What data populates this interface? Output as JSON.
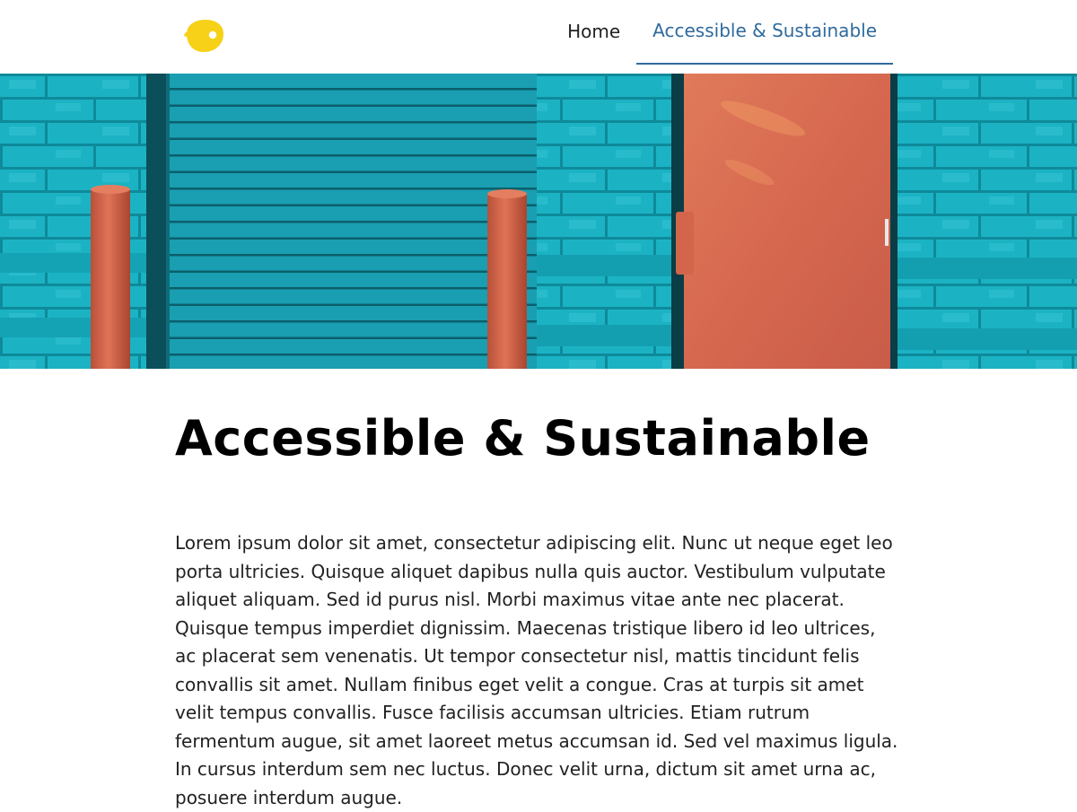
{
  "brand": {
    "logo": "lemon-logo-icon",
    "logo_color": "#f7d117"
  },
  "nav": {
    "items": [
      {
        "label": "Home"
      },
      {
        "label": "Accessible & Sustainable",
        "active": true
      }
    ],
    "active_color": "#2f6a9e"
  },
  "hero": {
    "image": "hero-image",
    "colors": {
      "wall": "#1ab0c2",
      "door": "#d9694f",
      "bollard": "#d4633d"
    }
  },
  "page": {
    "title": "Accessible & Sustainable",
    "body": "Lorem ipsum dolor sit amet, consectetur adipiscing elit. Nunc ut neque eget leo porta ultricies. Quisque aliquet dapibus nulla quis auctor. Vestibulum vulputate aliquet aliquam. Sed id purus nisl. Morbi maximus vitae ante nec placerat. Quisque tempus imperdiet dignissim. Maecenas tristique libero id leo ultrices, ac placerat sem venenatis. Ut tempor consectetur nisl, mattis tincidunt felis convallis sit amet. Nullam finibus eget velit a congue. Cras at turpis sit amet velit tempus convallis. Fusce facilisis accumsan ultricies. Etiam rutrum fermentum augue, sit amet laoreet metus accumsan id. Sed vel maximus ligula. In cursus interdum sem nec luctus. Donec velit urna, dictum sit amet urna ac, posuere interdum augue."
  }
}
